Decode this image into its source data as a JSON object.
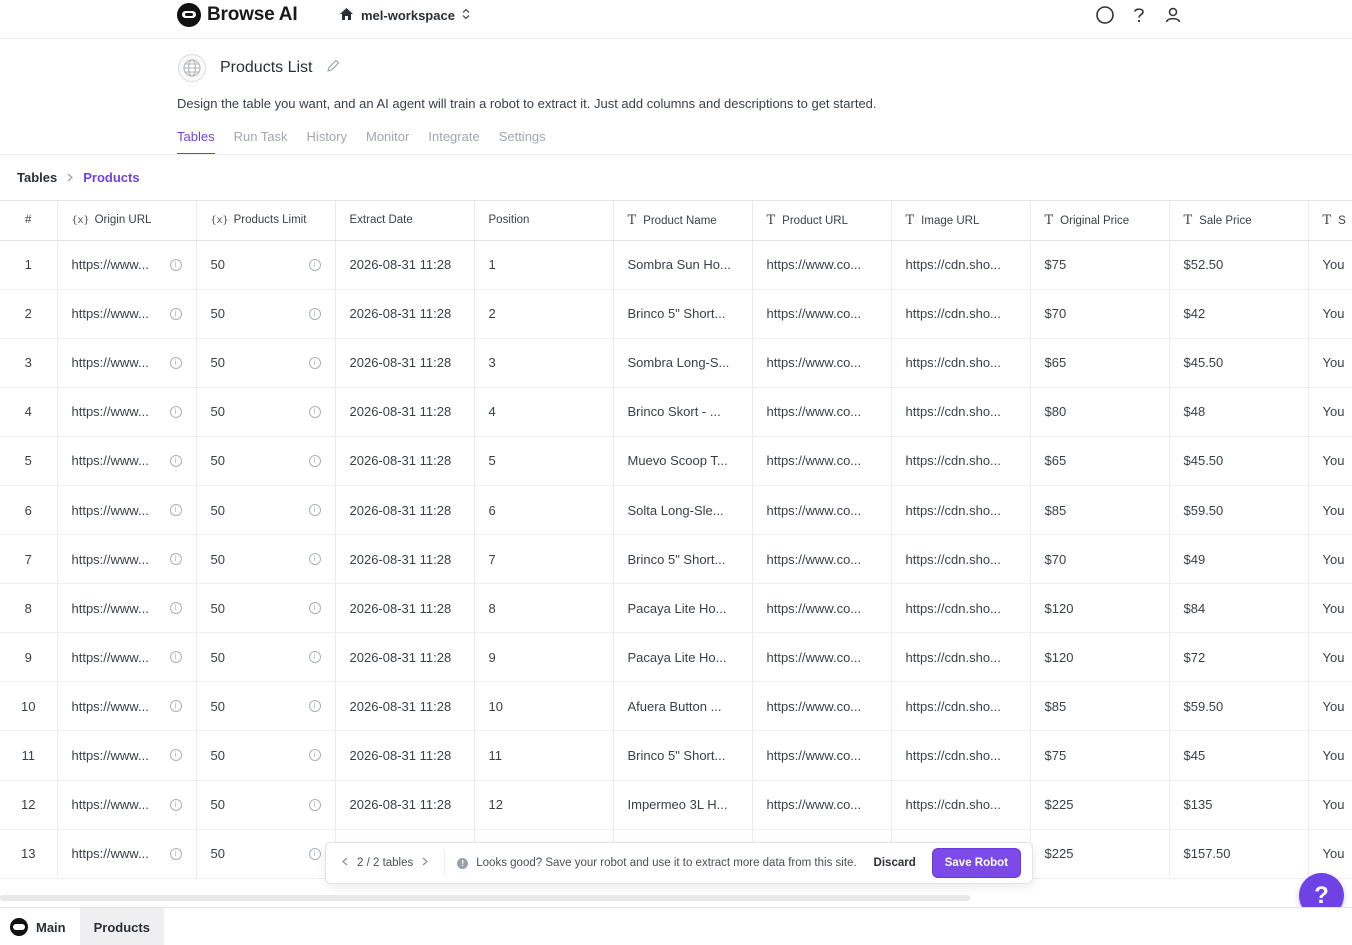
{
  "app": {
    "name": "Browse AI",
    "workspace": "mel-workspace"
  },
  "robot": {
    "title": "Products List",
    "description": "Design the table you want, and an AI agent will train a robot to extract it. Just add columns and descriptions to get started."
  },
  "tabs": [
    "Tables",
    "Run Task",
    "History",
    "Monitor",
    "Integrate",
    "Settings"
  ],
  "active_tab": "Tables",
  "breadcrumb": {
    "root": "Tables",
    "current": "Products"
  },
  "table": {
    "columns": [
      {
        "label": "#",
        "icon": ""
      },
      {
        "label": "Origin URL",
        "icon": "{x}"
      },
      {
        "label": "Products Limit",
        "icon": "{x}"
      },
      {
        "label": "Extract Date",
        "icon": ""
      },
      {
        "label": "Position",
        "icon": ""
      },
      {
        "label": "Product Name",
        "icon": "T"
      },
      {
        "label": "Product URL",
        "icon": "T"
      },
      {
        "label": "Image URL",
        "icon": "T"
      },
      {
        "label": "Original Price",
        "icon": "T"
      },
      {
        "label": "Sale Price",
        "icon": "T"
      },
      {
        "label": "S",
        "icon": "T"
      }
    ],
    "rows": [
      [
        "1",
        "https://www...",
        "50",
        "2026-08-31 11:28",
        "1",
        "Sombra Sun Ho...",
        "https://www.co...",
        "https://cdn.sho...",
        "$75",
        "$52.50",
        "You"
      ],
      [
        "2",
        "https://www...",
        "50",
        "2026-08-31 11:28",
        "2",
        "Brinco 5\" Short...",
        "https://www.co...",
        "https://cdn.sho...",
        "$70",
        "$42",
        "You"
      ],
      [
        "3",
        "https://www...",
        "50",
        "2026-08-31 11:28",
        "3",
        "Sombra Long-S...",
        "https://www.co...",
        "https://cdn.sho...",
        "$65",
        "$45.50",
        "You"
      ],
      [
        "4",
        "https://www...",
        "50",
        "2026-08-31 11:28",
        "4",
        "Brinco Skort - ...",
        "https://www.co...",
        "https://cdn.sho...",
        "$80",
        "$48",
        "You"
      ],
      [
        "5",
        "https://www...",
        "50",
        "2026-08-31 11:28",
        "5",
        "Muevo Scoop T...",
        "https://www.co...",
        "https://cdn.sho...",
        "$65",
        "$45.50",
        "You"
      ],
      [
        "6",
        "https://www...",
        "50",
        "2026-08-31 11:28",
        "6",
        "Solta Long-Sle...",
        "https://www.co...",
        "https://cdn.sho...",
        "$85",
        "$59.50",
        "You"
      ],
      [
        "7",
        "https://www...",
        "50",
        "2026-08-31 11:28",
        "7",
        "Brinco 5\" Short...",
        "https://www.co...",
        "https://cdn.sho...",
        "$70",
        "$49",
        "You"
      ],
      [
        "8",
        "https://www...",
        "50",
        "2026-08-31 11:28",
        "8",
        "Pacaya Lite Ho...",
        "https://www.co...",
        "https://cdn.sho...",
        "$120",
        "$84",
        "You"
      ],
      [
        "9",
        "https://www...",
        "50",
        "2026-08-31 11:28",
        "9",
        "Pacaya Lite Ho...",
        "https://www.co...",
        "https://cdn.sho...",
        "$120",
        "$72",
        "You"
      ],
      [
        "10",
        "https://www...",
        "50",
        "2026-08-31 11:28",
        "10",
        "Afuera Button ...",
        "https://www.co...",
        "https://cdn.sho...",
        "$85",
        "$59.50",
        "You"
      ],
      [
        "11",
        "https://www...",
        "50",
        "2026-08-31 11:28",
        "11",
        "Brinco 5\" Short...",
        "https://www.co...",
        "https://cdn.sho...",
        "$75",
        "$45",
        "You"
      ],
      [
        "12",
        "https://www...",
        "50",
        "2026-08-31 11:28",
        "12",
        "Impermeo 3L H...",
        "https://www.co...",
        "https://cdn.sho...",
        "$225",
        "$135",
        "You"
      ],
      [
        "13",
        "https://www...",
        "50",
        "",
        "",
        "",
        "",
        "",
        "$225",
        "$157.50",
        "You"
      ]
    ]
  },
  "save_bar": {
    "pager": "2 / 2 tables",
    "message": "Looks good? Save your robot and use it to extract more data from this site.",
    "discard_label": "Discard",
    "save_label": "Save Robot"
  },
  "help_label": "?",
  "bottom_tabs": [
    "Main",
    "Products"
  ],
  "colors": {
    "accent": "#6f42e6",
    "save_button": "#7b4ae8"
  },
  "icons": [
    "browse-ai-logo-icon",
    "home-icon",
    "chevron-updown-icon",
    "circle-icon",
    "help-icon",
    "user-icon",
    "globe-icon",
    "pencil-icon",
    "chevron-right-icon",
    "info-icon",
    "chevron-left-icon"
  ]
}
